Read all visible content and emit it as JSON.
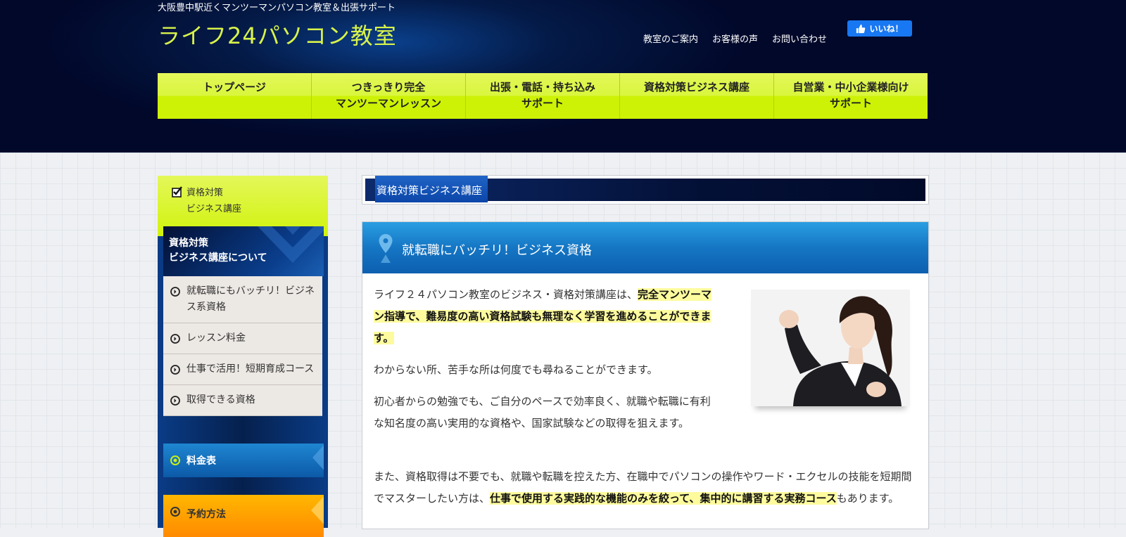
{
  "header": {
    "tagline": "大阪豊中駅近くマンツーマンパソコン教室＆出張サポート",
    "logo": "ライフ24パソコン教室",
    "links": [
      "教室のご案内",
      "お客様の声",
      "お問い合わせ"
    ],
    "fb_label": "いいね！"
  },
  "nav": {
    "items": [
      {
        "line1": "トップページ",
        "line2": ""
      },
      {
        "line1": "つきっきり完全",
        "line2": "マンツーマンレッスン"
      },
      {
        "line1": "出張・電話・持ち込み",
        "line2": "サポート"
      },
      {
        "line1": "資格対策ビジネス講座",
        "line2": ""
      },
      {
        "line1": "自営業・中小企業様向け",
        "line2": "サポート"
      }
    ]
  },
  "sidebar": {
    "current": {
      "line1": "資格対策",
      "line2": "ビジネス講座"
    },
    "section": {
      "line1": "資格対策",
      "line2": "ビジネス講座について"
    },
    "items": [
      "就転職にもバッチリ！ビジネス系資格",
      "レッスン料金",
      "仕事で活用！短期育成コース",
      "取得できる資格"
    ],
    "price_label": "料金表",
    "reserve_label": "予約方法"
  },
  "main": {
    "page_title": "資格対策ビジネス講座",
    "heading": "就転職にバッチリ！ビジネス資格",
    "p1_a": "ライフ２４パソコン教室のビジネス・資格対策講座は、",
    "p1_hl": "完全マンツーマン指導で、難易度の高い資格試験も無理なく学習を進めることができます。",
    "p2": "わからない所、苦手な所は何度でも尋ねることができます。",
    "p3": "初心者からの勉強でも、ご自分のペースで効率良く、就職や転職に有利な知名度の高い実用的な資格や、国家試験などの取得を狙えます。",
    "p4_a": "また、資格取得は不要でも、就職や転職を控えた方、在職中でパソコンの操作やワード・エクセルの技能を短期間でマスターしたい方は、",
    "p4_hl": "仕事で使用する実践的な機能のみを絞って、集中的に講習する実務コース",
    "p4_b": "もあります。"
  }
}
